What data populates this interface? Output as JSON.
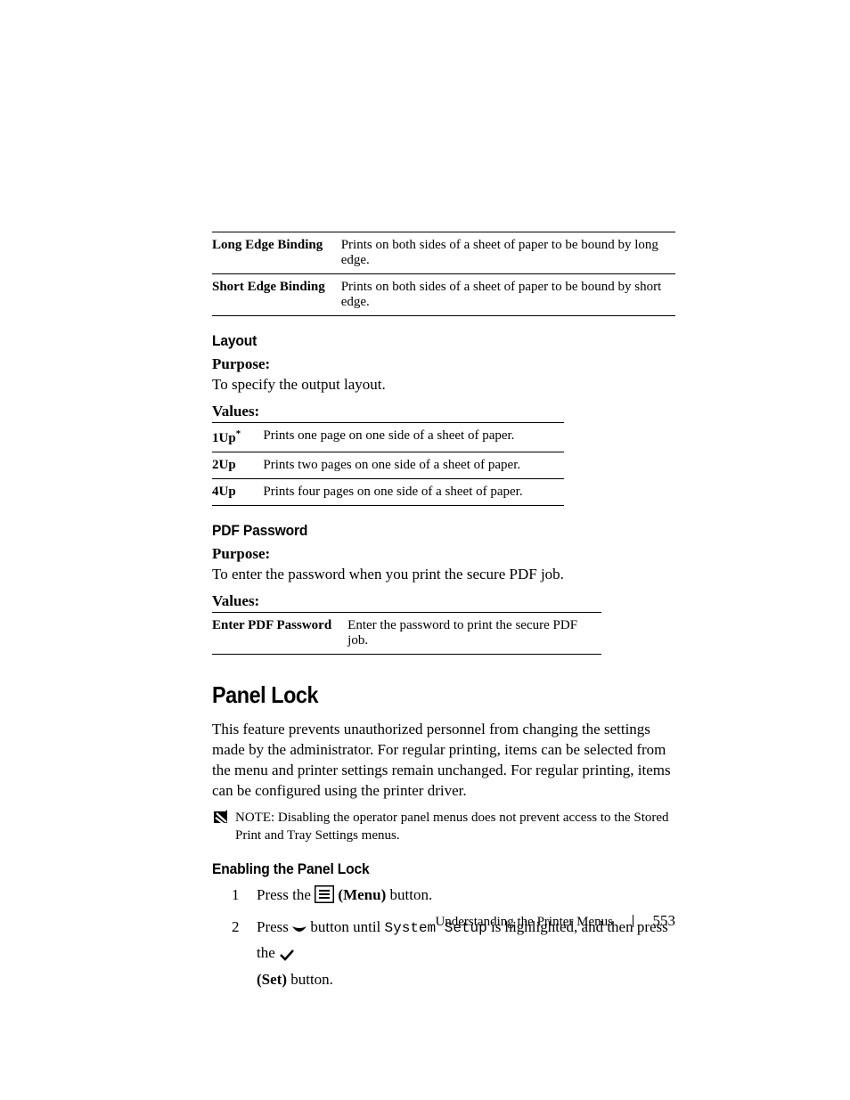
{
  "binding_table": {
    "rows": [
      {
        "term": "Long Edge Binding",
        "desc": "Prints on both sides of a sheet of paper to be bound by long edge."
      },
      {
        "term": "Short Edge Binding",
        "desc": "Prints on both sides of a sheet of paper to be bound by short edge."
      }
    ]
  },
  "layout_section": {
    "heading": "Layout",
    "purpose_label": "Purpose:",
    "purpose_text": "To specify the output layout.",
    "values_label": "Values:",
    "rows": [
      {
        "term": "1Up",
        "star": "*",
        "desc": "Prints one page on one side of a sheet of paper."
      },
      {
        "term": "2Up",
        "star": "",
        "desc": "Prints two pages on one side of a sheet of paper."
      },
      {
        "term": "4Up",
        "star": "",
        "desc": "Prints four pages on one side of a sheet of paper."
      }
    ]
  },
  "pdf_section": {
    "heading": "PDF Password",
    "purpose_label": "Purpose:",
    "purpose_text": "To enter the password when you print the secure PDF job.",
    "values_label": "Values:",
    "rows": [
      {
        "term": "Enter PDF Password",
        "desc": "Enter the password to print the secure PDF job."
      }
    ]
  },
  "panel_lock": {
    "heading": "Panel Lock",
    "body": "This feature prevents unauthorized personnel from changing the settings made by the administrator. For regular printing, items can be selected from the menu and printer settings remain unchanged. For regular printing, items can be configured using the printer driver.",
    "note_label": "NOTE: ",
    "note_text": "Disabling the operator panel menus does not prevent access to the Stored Print and Tray Settings menus."
  },
  "enable_section": {
    "heading": "Enabling the Panel Lock",
    "step1_a": "Press the ",
    "step1_b": " (Menu)",
    "step1_c": " button.",
    "step2_a": "Press ",
    "step2_b": " button until ",
    "step2_c": "System Setup",
    "step2_d": " is highlighted, and then press the ",
    "step2_e": "(Set)",
    "step2_f": " button."
  },
  "footer": {
    "title": "Understanding the Printer Menus",
    "page": "553"
  }
}
